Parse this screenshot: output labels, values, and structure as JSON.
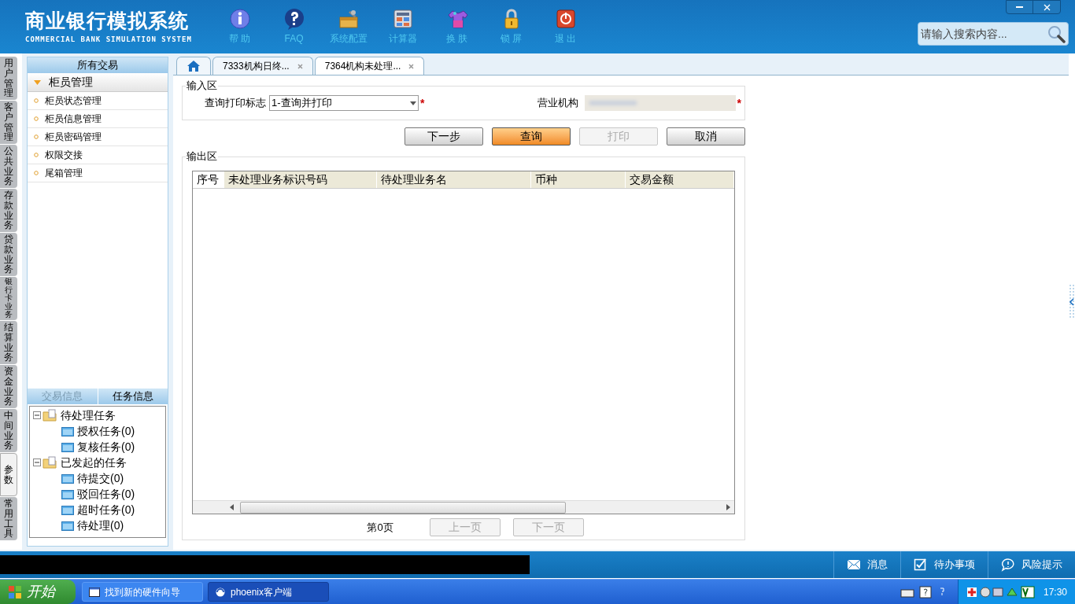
{
  "header": {
    "title": "商业银行模拟系统",
    "subtitle": "COMMERCIAL BANK SIMULATION SYSTEM",
    "toolbar": [
      {
        "kind": "info",
        "label": "帮 助"
      },
      {
        "kind": "help",
        "label": "FAQ"
      },
      {
        "kind": "config",
        "label": "系统配置"
      },
      {
        "kind": "calc",
        "label": "计算器"
      },
      {
        "kind": "skin",
        "label": "换 肤"
      },
      {
        "kind": "lock",
        "label": "锁 屏"
      },
      {
        "kind": "exit",
        "label": "退 出"
      }
    ],
    "search": {
      "placeholder": "请输入搜索内容..."
    }
  },
  "side_tabs": [
    {
      "label": "用户管理",
      "selected": false
    },
    {
      "label": "客户管理",
      "selected": false
    },
    {
      "label": "公共业务",
      "selected": false
    },
    {
      "label": "存款业务",
      "selected": false
    },
    {
      "label": "贷款业务",
      "selected": false
    },
    {
      "label": "银行卡业务",
      "selected": false
    },
    {
      "label": "结算业务",
      "selected": false
    },
    {
      "label": "资金业务",
      "selected": false
    },
    {
      "label": "中间业务",
      "selected": false
    },
    {
      "label": "参数",
      "selected": true
    },
    {
      "label": "常用工具",
      "selected": false
    }
  ],
  "menu": {
    "title": "所有交易",
    "group": {
      "label": "柜员管理",
      "expanded": true
    },
    "items": [
      "柜员状态管理",
      "柜员信息管理",
      "柜员密码管理",
      "权限交接",
      "尾箱管理"
    ]
  },
  "info_tabs": [
    {
      "label": "交易信息",
      "selected": false
    },
    {
      "label": "任务信息",
      "selected": true
    }
  ],
  "task_tree": [
    {
      "label": "待处理任务",
      "children": [
        {
          "label": "授权任务(0)"
        },
        {
          "label": "复核任务(0)"
        }
      ]
    },
    {
      "label": "已发起的任务",
      "children": [
        {
          "label": "待提交(0)"
        },
        {
          "label": "驳回任务(0)"
        },
        {
          "label": "超时任务(0)"
        },
        {
          "label": "待处理(0)"
        }
      ]
    }
  ],
  "tabs": [
    {
      "kind": "home",
      "selected": false
    },
    {
      "kind": "page",
      "label": "7333机构日终...",
      "selected": false
    },
    {
      "kind": "page",
      "label": "7364机构未处理...",
      "selected": true
    }
  ],
  "input_area": {
    "title": "输入区",
    "required_mark": "*",
    "fields": [
      {
        "label": "查询打印标志",
        "value": "1-查询并打印",
        "kind": "select",
        "required": true
      },
      {
        "label": "营业机构",
        "kind": "blurred",
        "required": true
      }
    ]
  },
  "buttons": [
    {
      "label": "下一步",
      "primary": false,
      "disabled": false
    },
    {
      "label": "查询",
      "primary": true,
      "disabled": false
    },
    {
      "label": "打印",
      "primary": false,
      "disabled": true
    },
    {
      "label": "取消",
      "primary": false,
      "disabled": false
    }
  ],
  "output_area": {
    "title": "输出区",
    "table": {
      "columns": [
        "序号",
        "未处理业务标识号码",
        "待处理业务名",
        "币种",
        "交易金额"
      ]
    }
  },
  "pager": {
    "page": "第0页",
    "prev": {
      "label": "上一页",
      "disabled": true
    },
    "next": {
      "label": "下一页",
      "disabled": true
    }
  },
  "status_bar": [
    {
      "kind": "mail",
      "label": "消息"
    },
    {
      "kind": "check",
      "label": "待办事项"
    },
    {
      "kind": "bubble",
      "label": "风险提示"
    }
  ],
  "taskbar": {
    "start": "开始",
    "windows": [
      {
        "label": "找到新的硬件向导",
        "selected": false
      },
      {
        "label": "phoenix客户端",
        "selected": true
      }
    ],
    "clock": "17:30"
  }
}
